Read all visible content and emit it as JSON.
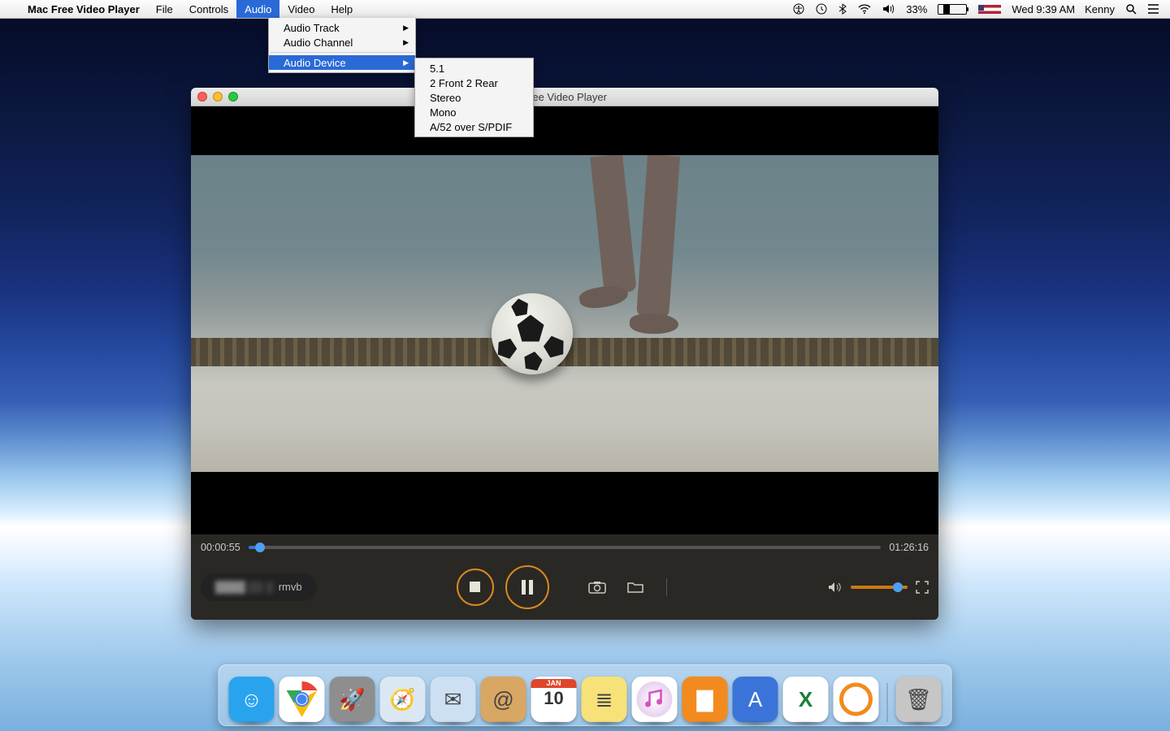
{
  "menubar": {
    "app_name": "Mac Free Video Player",
    "items": [
      "File",
      "Controls",
      "Audio",
      "Video",
      "Help"
    ],
    "open_index": 2,
    "right": {
      "battery_pct": "33%",
      "day_time": "Wed 9:39 AM",
      "user": "Kenny"
    }
  },
  "audio_menu": {
    "items": [
      {
        "label": "Audio Track",
        "submenu": true
      },
      {
        "label": "Audio Channel",
        "submenu": true
      },
      {
        "label": "Audio Device",
        "submenu": true,
        "selected": true
      }
    ]
  },
  "audio_device_submenu": [
    "5.1",
    "2 Front 2 Rear",
    "Stereo",
    "Mono",
    "A/52 over S/PDIF"
  ],
  "player": {
    "window_title": "Free Video Player",
    "elapsed": "00:00:55",
    "remaining": "01:26:16",
    "progress_pct": 1.1,
    "filename_visible_suffix": "rmvb"
  },
  "dock": [
    {
      "name": "finder",
      "bg": "#2aa3ef",
      "glyph": "☺"
    },
    {
      "name": "chrome",
      "bg": "#ffffff",
      "glyph": "◉"
    },
    {
      "name": "launchpad",
      "bg": "#8e8e8e",
      "glyph": "🚀"
    },
    {
      "name": "safari",
      "bg": "#dbe8f4",
      "glyph": "🧭"
    },
    {
      "name": "mail",
      "bg": "#cddff2",
      "glyph": "✉"
    },
    {
      "name": "contacts",
      "bg": "#d8a763",
      "glyph": "@"
    },
    {
      "name": "calendar",
      "bg": "#ffffff",
      "glyph": "10"
    },
    {
      "name": "notes",
      "bg": "#f7e27a",
      "glyph": "≣"
    },
    {
      "name": "itunes",
      "bg": "#ffffff",
      "glyph": "♪"
    },
    {
      "name": "ibooks",
      "bg": "#f28a1e",
      "glyph": "▇"
    },
    {
      "name": "appstore",
      "bg": "#3b74d8",
      "glyph": "A"
    },
    {
      "name": "excel",
      "bg": "#ffffff",
      "glyph": "✕"
    },
    {
      "name": "app-orange",
      "bg": "#ffffff",
      "glyph": "◯"
    },
    {
      "name": "trash",
      "bg": "#c6c6c6",
      "glyph": "🗑"
    }
  ]
}
